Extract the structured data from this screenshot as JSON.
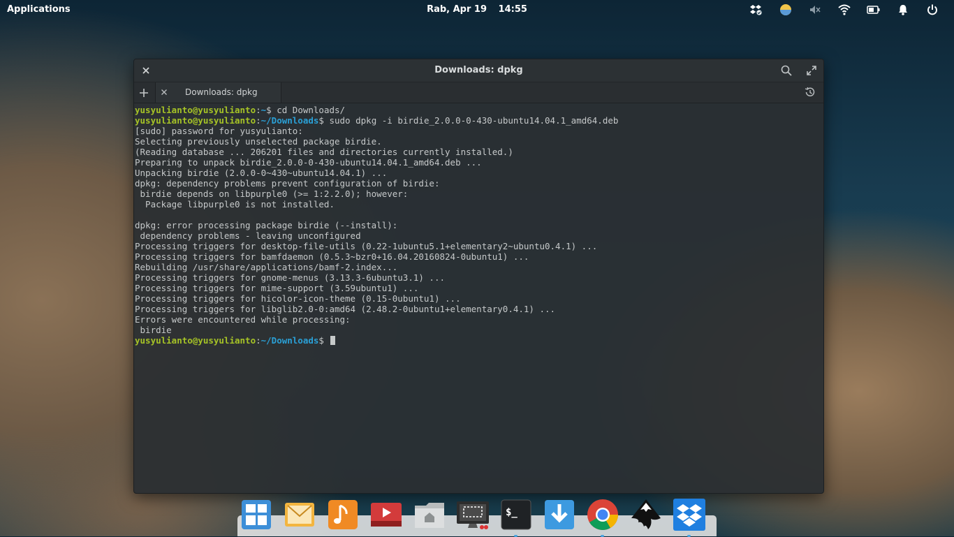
{
  "panel": {
    "applications_label": "Applications",
    "date": "Rab, Apr 19",
    "time": "14:55",
    "indicators": [
      "dropbox-sync-icon",
      "night-light-icon",
      "volume-muted-icon",
      "wifi-icon",
      "battery-icon",
      "notifications-icon",
      "power-icon"
    ]
  },
  "window": {
    "title": "Downloads: dpkg",
    "tabs": [
      {
        "label": "Downloads: dpkg"
      }
    ]
  },
  "terminal": {
    "lines": [
      {
        "user": "yusyulianto@yusyulianto",
        "path": "~",
        "cmd": "cd Downloads/"
      },
      {
        "user": "yusyulianto@yusyulianto",
        "path": "~/Downloads",
        "cmd": "sudo dpkg -i birdie_2.0.0-0-430-ubuntu14.04.1_amd64.deb"
      },
      {
        "text": "[sudo] password for yusyulianto:"
      },
      {
        "text": "Selecting previously unselected package birdie."
      },
      {
        "text": "(Reading database ... 206201 files and directories currently installed.)"
      },
      {
        "text": "Preparing to unpack birdie_2.0.0-0-430-ubuntu14.04.1_amd64.deb ..."
      },
      {
        "text": "Unpacking birdie (2.0.0-0~430~ubuntu14.04.1) ..."
      },
      {
        "text": "dpkg: dependency problems prevent configuration of birdie:"
      },
      {
        "text": " birdie depends on libpurple0 (>= 1:2.2.0); however:"
      },
      {
        "text": "  Package libpurple0 is not installed."
      },
      {
        "text": ""
      },
      {
        "text": "dpkg: error processing package birdie (--install):"
      },
      {
        "text": " dependency problems - leaving unconfigured"
      },
      {
        "text": "Processing triggers for desktop-file-utils (0.22-1ubuntu5.1+elementary2~ubuntu0.4.1) ..."
      },
      {
        "text": "Processing triggers for bamfdaemon (0.5.3~bzr0+16.04.20160824-0ubuntu1) ..."
      },
      {
        "text": "Rebuilding /usr/share/applications/bamf-2.index..."
      },
      {
        "text": "Processing triggers for gnome-menus (3.13.3-6ubuntu3.1) ..."
      },
      {
        "text": "Processing triggers for mime-support (3.59ubuntu1) ..."
      },
      {
        "text": "Processing triggers for hicolor-icon-theme (0.15-0ubuntu1) ..."
      },
      {
        "text": "Processing triggers for libglib2.0-0:amd64 (2.48.2-0ubuntu1+elementary0.4.1) ..."
      },
      {
        "text": "Errors were encountered while processing:"
      },
      {
        "text": " birdie"
      },
      {
        "user": "yusyulianto@yusyulianto",
        "path": "~/Downloads",
        "cmd": "",
        "cursor": true
      }
    ],
    "colors": {
      "user": "#a6c326",
      "path": "#2aa0d6",
      "text": "#c6c9ca"
    }
  },
  "dock": {
    "items": [
      {
        "name": "multitasking-view",
        "icon": "multitasking-icon",
        "running": false
      },
      {
        "name": "mail",
        "icon": "mail-icon",
        "running": false
      },
      {
        "name": "music",
        "icon": "music-icon",
        "running": false
      },
      {
        "name": "videos",
        "icon": "videos-icon",
        "running": false
      },
      {
        "name": "files",
        "icon": "files-icon",
        "running": false
      },
      {
        "name": "screenshot",
        "icon": "screenshot-icon",
        "running": false
      },
      {
        "name": "terminal",
        "icon": "terminal-icon",
        "running": true
      },
      {
        "name": "downloads",
        "icon": "download-icon",
        "running": false
      },
      {
        "name": "chrome",
        "icon": "chrome-icon",
        "running": true
      },
      {
        "name": "inkscape",
        "icon": "inkscape-icon",
        "running": false
      },
      {
        "name": "dropbox",
        "icon": "dropbox-icon",
        "running": true
      }
    ]
  }
}
